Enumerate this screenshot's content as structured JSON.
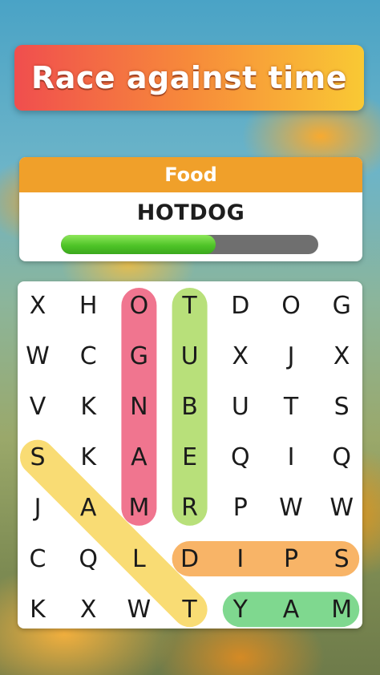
{
  "banner": {
    "title": "Race against time"
  },
  "puzzle": {
    "category": "Food",
    "current_word": "HOTDOG",
    "progress": 0.6
  },
  "grid": {
    "rows": [
      [
        "X",
        "H",
        "O",
        "T",
        "D",
        "O",
        "G"
      ],
      [
        "W",
        "C",
        "G",
        "U",
        "X",
        "J",
        "X"
      ],
      [
        "V",
        "K",
        "N",
        "B",
        "U",
        "T",
        "S"
      ],
      [
        "S",
        "K",
        "A",
        "E",
        "Q",
        "I",
        "Q"
      ],
      [
        "J",
        "A",
        "M",
        "R",
        "P",
        "W",
        "W"
      ],
      [
        "C",
        "Q",
        "L",
        "D",
        "I",
        "P",
        "S"
      ],
      [
        "K",
        "X",
        "W",
        "T",
        "Y",
        "A",
        "M"
      ]
    ]
  },
  "found_words": [
    {
      "word": "MANGO",
      "from": [
        4,
        2
      ],
      "to": [
        0,
        2
      ],
      "color": "#f0758f"
    },
    {
      "word": "TUBER",
      "from": [
        0,
        3
      ],
      "to": [
        4,
        3
      ],
      "color": "#b8e07a"
    },
    {
      "word": "SALT",
      "from": [
        3,
        0
      ],
      "to": [
        6,
        3
      ],
      "color": "#f9dc74"
    },
    {
      "word": "DIPS",
      "from": [
        5,
        3
      ],
      "to": [
        5,
        6
      ],
      "color": "#f8b467"
    },
    {
      "word": "YAM",
      "from": [
        6,
        4
      ],
      "to": [
        6,
        6
      ],
      "color": "#7fd88f"
    }
  ]
}
